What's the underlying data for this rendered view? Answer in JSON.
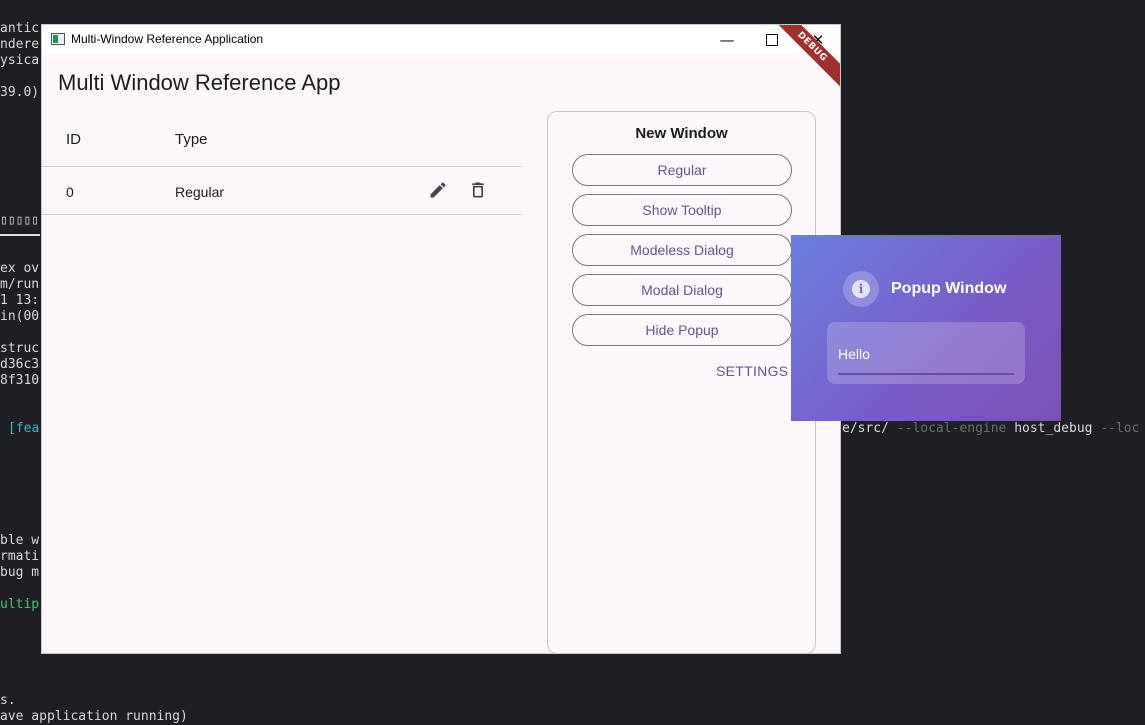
{
  "terminal": {
    "lines": [
      "antic",
      "ndere",
      "ysica",
      "39.0)",
      "▯▯▯▯▯",
      "ex ov",
      "m/run",
      "1 13:",
      "in(00",
      "struc",
      "d36c3",
      "8f310",
      "[fea",
      "ble w",
      "rmati",
      "bug m",
      "ultip",
      "s.",
      "ave application running)"
    ],
    "right_path": "e/src/",
    "right_flag1": "--local-engine",
    "right_value": "host_debug",
    "right_flag2": "--loc"
  },
  "window": {
    "title": "Multi-Window Reference Application",
    "minimize_glyph": "—",
    "close_glyph": "✕",
    "debug_banner": "DEBUG"
  },
  "app": {
    "title": "Multi Window Reference App"
  },
  "table": {
    "headers": {
      "id": "ID",
      "type": "Type"
    },
    "rows": [
      {
        "id": "0",
        "type": "Regular"
      }
    ]
  },
  "panel": {
    "title": "New Window",
    "buttons": [
      "Regular",
      "Show Tooltip",
      "Modeless Dialog",
      "Modal Dialog",
      "Hide Popup"
    ],
    "settings": "SETTINGS"
  },
  "popup": {
    "title": "Popup Window",
    "icon_glyph": "i",
    "field_value": "Hello"
  }
}
